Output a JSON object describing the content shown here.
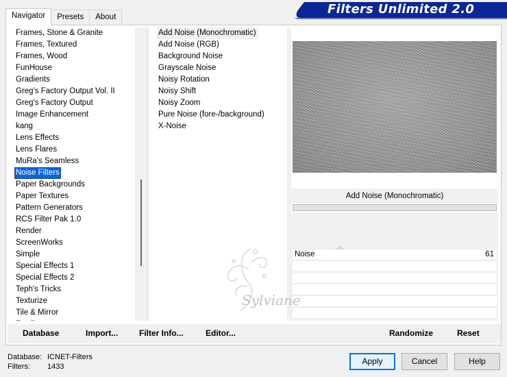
{
  "window": {
    "banner_title": "Filters Unlimited 2.0",
    "accent_color": "#0b2696"
  },
  "tabs": [
    {
      "label": "Navigator",
      "active": true
    },
    {
      "label": "Presets",
      "active": false
    },
    {
      "label": "About",
      "active": false
    }
  ],
  "categories": {
    "items": [
      "Frames, Stone & Granite",
      "Frames, Textured",
      "Frames, Wood",
      "FunHouse",
      "Gradients",
      "Greg's Factory Output Vol. II",
      "Greg's Factory Output",
      "Image Enhancement",
      "kang",
      "Lens Effects",
      "Lens Flares",
      "MuRa's Seamless",
      "Noise Filters",
      "Paper Backgrounds",
      "Paper Textures",
      "Pattern Generators",
      "RCS Filter Pak 1.0",
      "Render",
      "ScreenWorks",
      "Simple",
      "Special Effects 1",
      "Special Effects 2",
      "Teph's Tricks",
      "Texturize",
      "Tile & Mirror",
      "Toadies"
    ],
    "selected": "Noise Filters"
  },
  "filters": {
    "items": [
      "Add Noise (Monochromatic)",
      "Add Noise (RGB)",
      "Background Noise",
      "Grayscale Noise",
      "Noisy Rotation",
      "Noisy Shift",
      "Noisy Zoom",
      "Pure Noise (fore-/background)",
      "X-Noise"
    ],
    "current": "Add Noise (Monochromatic)"
  },
  "preview": {
    "filter_title": "Add Noise (Monochromatic)"
  },
  "parameters": [
    {
      "label": "Noise",
      "value": "61"
    }
  ],
  "toolbar": {
    "database_label": "Database",
    "import_label": "Import...",
    "filter_info_label": "Filter Info...",
    "editor_label": "Editor...",
    "randomize_label": "Randomize",
    "reset_label": "Reset"
  },
  "status": {
    "database_label": "Database:",
    "database_value": "ICNET-Filters",
    "filters_label": "Filters:",
    "filters_value": "1433"
  },
  "buttons": {
    "apply": "Apply",
    "cancel": "Cancel",
    "help": "Help"
  },
  "watermark_text": "Sylviane"
}
